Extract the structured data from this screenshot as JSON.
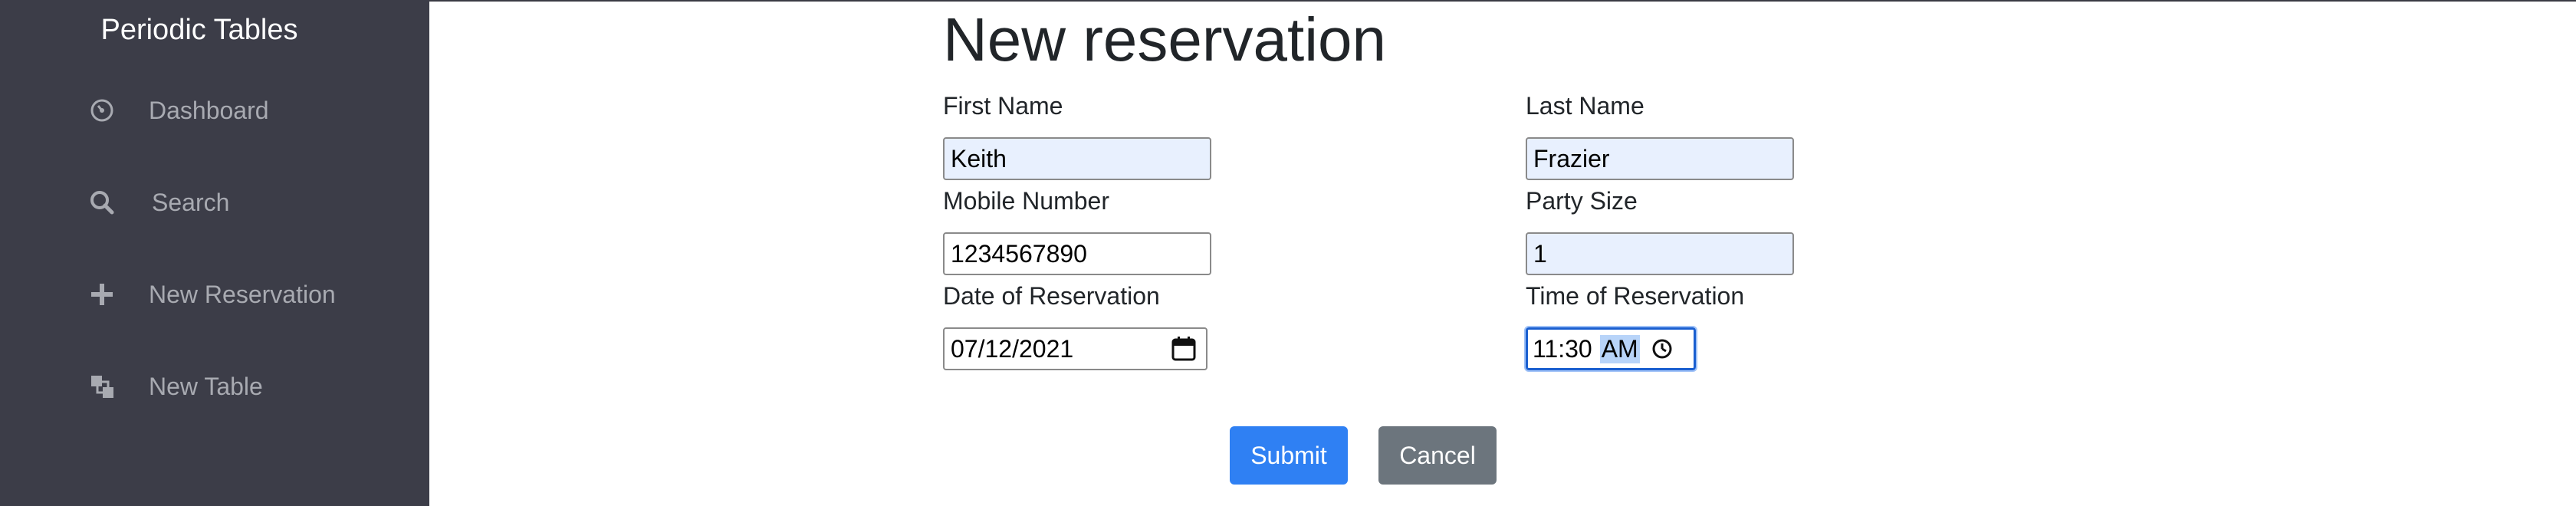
{
  "sidebar": {
    "brand": "Periodic Tables",
    "items": [
      {
        "label": "Dashboard",
        "icon": "dashboard-icon"
      },
      {
        "label": "Search",
        "icon": "search-icon"
      },
      {
        "label": "New Reservation",
        "icon": "plus-icon"
      },
      {
        "label": "New Table",
        "icon": "layers-icon"
      }
    ]
  },
  "form": {
    "title": "New reservation",
    "first_name": {
      "label": "First Name",
      "value": "Keith"
    },
    "last_name": {
      "label": "Last Name",
      "value": "Frazier"
    },
    "mobile_number": {
      "label": "Mobile Number",
      "value": "1234567890"
    },
    "party_size": {
      "label": "Party Size",
      "value": "1"
    },
    "date": {
      "label": "Date of Reservation",
      "value": "07/12/2021"
    },
    "time": {
      "label": "Time of Reservation",
      "value": "11:30",
      "period": "AM"
    },
    "submit_label": "Submit",
    "cancel_label": "Cancel"
  },
  "colors": {
    "sidebar_bg": "#3c3d48",
    "submit_bg": "#2f80f3",
    "cancel_bg": "#6c757d",
    "autofill_bg": "#e8f0fe"
  }
}
